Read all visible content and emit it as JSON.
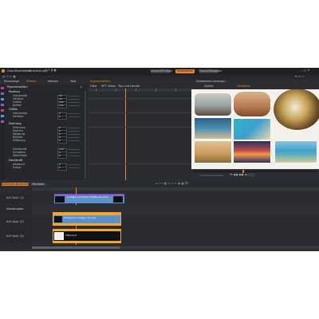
{
  "menu": {
    "items": [
      "Datei",
      "Bearbeiten",
      "Einstellungen"
    ],
    "tabs": [
      "Import/Einfüge",
      "Bearbeiten",
      "Export/Stoppen"
    ],
    "active_tab": 1
  },
  "library_tabs": [
    "Ehemalige",
    "Effekte",
    "Medien",
    "Text"
  ],
  "editor_tabs": [
    "Eigenschaften",
    "Filter",
    "SPT Video",
    "Ton und Deckel"
  ],
  "properties": {
    "title": "Eigenschaften",
    "sections": [
      "Position",
      "Größe",
      "Drehung",
      "Deckkraft"
    ],
    "rows": [
      {
        "label": "Horizontal",
        "value": "50"
      },
      {
        "label": "Vertikal",
        "value": "50"
      },
      {
        "label": "Größe",
        "value": "100"
      },
      {
        "label": "Breite",
        "value": "100"
      },
      {
        "label": "Horizontal",
        "value": "0"
      },
      {
        "label": "Vertikal",
        "value": "0"
      },
      {
        "label": "Drehung",
        "value": "0"
      },
      {
        "label": "Drehen",
        "value": "0"
      },
      {
        "label": "Neigung",
        "value": "0"
      },
      {
        "label": "Blende",
        "value": "0"
      },
      {
        "label": "Glättung",
        "value": "0"
      },
      {
        "label": "Deckkraft",
        "value": "100"
      },
      {
        "label": "Schatten",
        "value": "0"
      },
      {
        "label": "Weichheit",
        "value": "0"
      },
      {
        "label": "Abstand",
        "value": "0"
      },
      {
        "label": "Farbe",
        "value": "0"
      }
    ]
  },
  "preview": {
    "header": "Zeitleisten-Vorschau",
    "tabs": [
      "Quelle",
      "Zeitleiste"
    ],
    "active_tab": 1
  },
  "timeline": {
    "bin_tabs": [
      "Zeitleiste-Bearbeitung",
      "Filmfolie"
    ],
    "tracks": [
      {
        "name": "A/V Spur (1)",
        "clip": "Collage und Bilder SNDMusik.mp4"
      },
      {
        "name": "Wiedergabe",
        "clip": ""
      },
      {
        "name": "A/V Spur (2)",
        "clip": "Fotoalbum Collage 4K.mp4"
      },
      {
        "name": "A/V Spur (3)",
        "clip": "Titel.mp4"
      }
    ]
  },
  "colors": {
    "accent": "#e8822d",
    "clip_blue": "#5d8fc9",
    "clip_orange": "#f0a830",
    "playhead": "#e8822d"
  }
}
